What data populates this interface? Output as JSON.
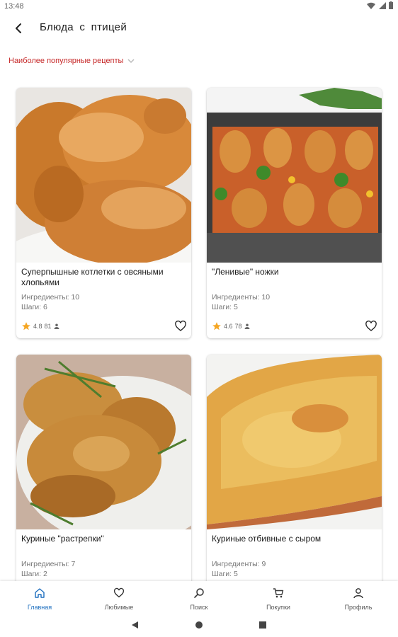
{
  "status": {
    "time": "13:48"
  },
  "header": {
    "title": "Блюда с птицей"
  },
  "sort": {
    "label": "Наиболее популярные рецепты"
  },
  "recipes": [
    {
      "title": "Суперпышные котлетки с овсяными хлопьями",
      "ingredients": "Ингредиенты: 10",
      "steps": "Шаги: 6",
      "rating": "4.8",
      "reviews": "81"
    },
    {
      "title": "\"Ленивые\" ножки",
      "ingredients": "Ингредиенты: 10",
      "steps": "Шаги: 5",
      "rating": "4.6",
      "reviews": "78"
    },
    {
      "title": "Куриные \"растрепки\"",
      "ingredients": "Ингредиенты: 7",
      "steps": "Шаги: 2"
    },
    {
      "title": "Куриные отбивные с сыром",
      "ingredients": "Ингредиенты: 9",
      "steps": "Шаги: 5"
    }
  ],
  "nav": [
    {
      "label": "Главная",
      "icon": "home-icon"
    },
    {
      "label": "Любимые",
      "icon": "heart-icon"
    },
    {
      "label": "Поиск",
      "icon": "search-icon"
    },
    {
      "label": "Покупки",
      "icon": "cart-icon"
    },
    {
      "label": "Профиль",
      "icon": "person-icon"
    }
  ],
  "colors": {
    "accent": "#1e6fbf",
    "sort_text": "#c62828",
    "star": "#f5a623"
  }
}
